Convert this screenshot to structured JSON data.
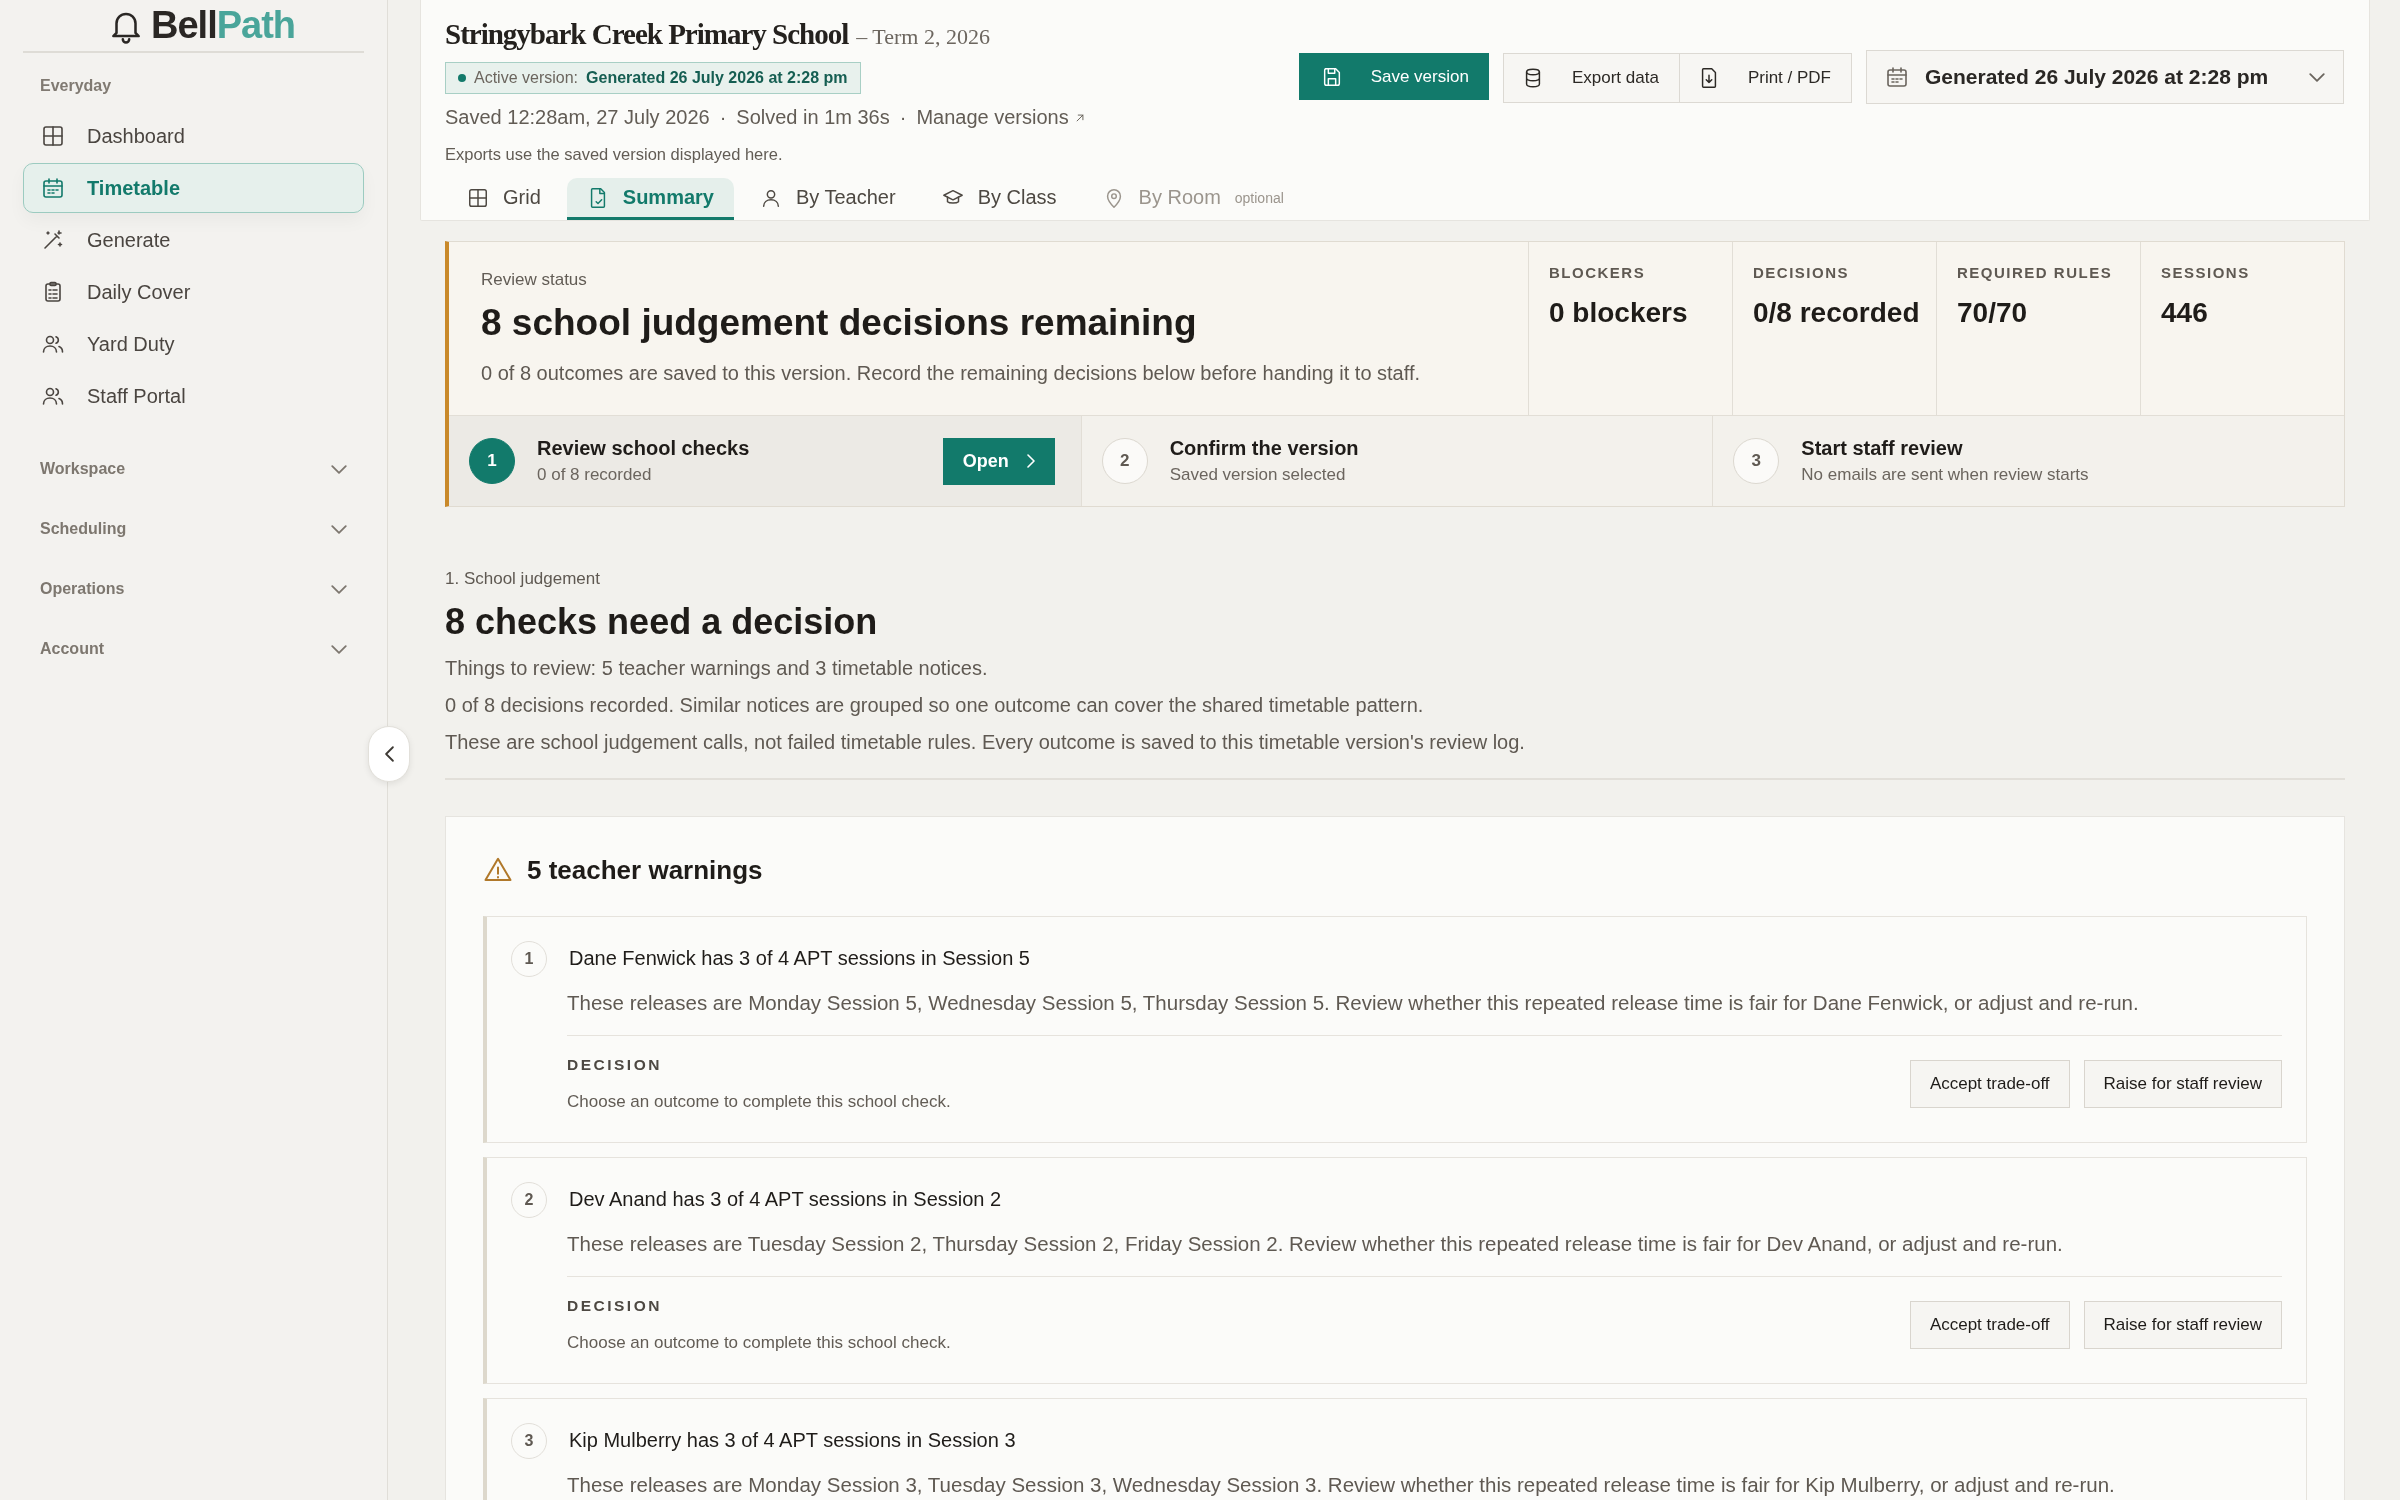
{
  "sidebar": {
    "logo": {
      "first": "Bell",
      "second": "Path"
    },
    "sections": [
      {
        "kind": "list",
        "label": "Everyday",
        "items": [
          {
            "label": "Dashboard",
            "selected": false
          },
          {
            "label": "Timetable",
            "selected": true
          },
          {
            "label": "Generate",
            "selected": false
          },
          {
            "label": "Daily Cover",
            "selected": false
          },
          {
            "label": "Yard Duty",
            "selected": false
          },
          {
            "label": "Staff Portal",
            "selected": false
          }
        ]
      },
      {
        "kind": "group",
        "label": "Workspace",
        "expanded": false
      },
      {
        "kind": "group",
        "label": "Scheduling",
        "expanded": false
      },
      {
        "kind": "group",
        "label": "Operations",
        "expanded": false
      },
      {
        "kind": "group",
        "label": "Account",
        "expanded": false
      }
    ]
  },
  "header": {
    "title": "Stringybark Creek Primary School",
    "term": "– Term 2, 2026",
    "active_version": {
      "label": "Active version:",
      "value": "Generated 26 July 2026 at 2:28 pm"
    },
    "meta": [
      "Saved 12:28am, 27 July 2026",
      "·",
      "Solved in 1m 36s",
      "·"
    ],
    "manage_link": "Manage versions",
    "note": "Exports use the saved version displayed here.",
    "actions": [
      {
        "label": "Save version",
        "kind": "primary"
      },
      {
        "label": "Export data",
        "kind": "secondary"
      },
      {
        "label": "Print / PDF",
        "kind": "secondary"
      }
    ],
    "version_select": {
      "value": "Generated 26 July 2026 at 2:28 pm"
    }
  },
  "tabs": [
    {
      "label": "Grid",
      "selected": false,
      "disabled": false
    },
    {
      "label": "Summary",
      "selected": true,
      "disabled": false
    },
    {
      "label": "By Teacher",
      "selected": false,
      "disabled": false
    },
    {
      "label": "By Class",
      "selected": false,
      "disabled": false
    },
    {
      "label": "By Room",
      "selected": false,
      "disabled": true,
      "tag": "optional"
    }
  ],
  "review_status": {
    "label": "Review status",
    "heading": "8 school judgement decisions remaining",
    "summary": "0 of 8 outcomes are saved to this version. Record the remaining decisions below before handing it to staff.",
    "stats": [
      {
        "label": "BLOCKERS",
        "value": "0 blockers"
      },
      {
        "label": "DECISIONS",
        "value": "0/8 recorded"
      },
      {
        "label": "REQUIRED RULES",
        "value": "70/70"
      },
      {
        "label": "SESSIONS",
        "value": "446"
      }
    ],
    "steps": [
      {
        "number": "1",
        "title": "Review school checks",
        "subtitle": "0 of 8 recorded",
        "current": true,
        "action": "Open"
      },
      {
        "number": "2",
        "title": "Confirm the version",
        "subtitle": "Saved version selected",
        "current": false
      },
      {
        "number": "3",
        "title": "Start staff review",
        "subtitle": "No emails are sent when review starts",
        "current": false
      }
    ]
  },
  "section": {
    "eyebrow": "1. School judgement",
    "heading": "8 checks need a decision",
    "lines": [
      "Things to review: 5 teacher warnings and 3 timetable notices.",
      "0 of 8 decisions recorded. Similar notices are grouped so one outcome can cover the shared timetable pattern.",
      "These are school judgement calls, not failed timetable rules. Every outcome is saved to this timetable version's review log."
    ]
  },
  "warnings": {
    "title": "5 teacher warnings",
    "items": [
      {
        "number": "1",
        "title": "Dane Fenwick has 3 of 4 APT sessions in Session 5",
        "description": "These releases are Monday Session 5, Wednesday Session 5, Thursday Session 5. Review whether this repeated release time is fair for Dane Fenwick, or adjust and re-run.",
        "decision_label": "DECISION",
        "decision_note": "Choose an outcome to complete this school check.",
        "buttons": [
          "Accept trade-off",
          "Raise for staff review"
        ]
      },
      {
        "number": "2",
        "title": "Dev Anand has 3 of 4 APT sessions in Session 2",
        "description": "These releases are Tuesday Session 2, Thursday Session 2, Friday Session 2. Review whether this repeated release time is fair for Dev Anand, or adjust and re-run.",
        "decision_label": "DECISION",
        "decision_note": "Choose an outcome to complete this school check.",
        "buttons": [
          "Accept trade-off",
          "Raise for staff review"
        ]
      },
      {
        "number": "3",
        "title": "Kip Mulberry has 3 of 4 APT sessions in Session 3",
        "description": "These releases are Monday Session 3, Tuesday Session 3, Wednesday Session 3. Review whether this repeated release time is fair for Kip Mulberry, or adjust and re-run."
      }
    ]
  }
}
